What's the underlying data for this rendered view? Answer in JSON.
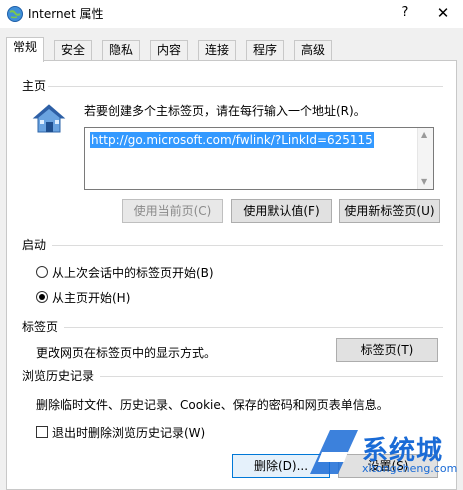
{
  "window": {
    "title": "Internet 属性",
    "help": "?",
    "close": "✕"
  },
  "tabs": [
    {
      "label": "常规",
      "active": true
    },
    {
      "label": "安全"
    },
    {
      "label": "隐私"
    },
    {
      "label": "内容"
    },
    {
      "label": "连接"
    },
    {
      "label": "程序"
    },
    {
      "label": "高级"
    }
  ],
  "home": {
    "section": "主页",
    "instruction": "若要创建多个主标签页，请在每行输入一个地址(R)。",
    "url": "http://go.microsoft.com/fwlink/?LinkId=625115",
    "buttons": {
      "use_current": "使用当前页(C)",
      "use_default": "使用默认值(F)",
      "use_new_tab": "使用新标签页(U)"
    }
  },
  "startup": {
    "section": "启动",
    "options": [
      {
        "label": "从上次会话中的标签页开始(B)",
        "selected": false
      },
      {
        "label": "从主页开始(H)",
        "selected": true
      }
    ]
  },
  "tabs_section": {
    "section": "标签页",
    "description": "更改网页在标签页中的显示方式。",
    "button": "标签页(T)"
  },
  "history": {
    "section": "浏览历史记录",
    "description": "删除临时文件、历史记录、Cookie、保存的密码和网页表单信息。",
    "checkbox": {
      "label": "退出时删除浏览历史记录(W)",
      "checked": false
    },
    "delete_button": "删除(D)...",
    "settings_button": "设置(S)"
  },
  "watermark": {
    "text": "系统城",
    "sub": "xitongcheng.com"
  },
  "colors": {
    "accent": "#0078d7",
    "selection": "#3399ff",
    "watermark": "#1a6bd6"
  }
}
